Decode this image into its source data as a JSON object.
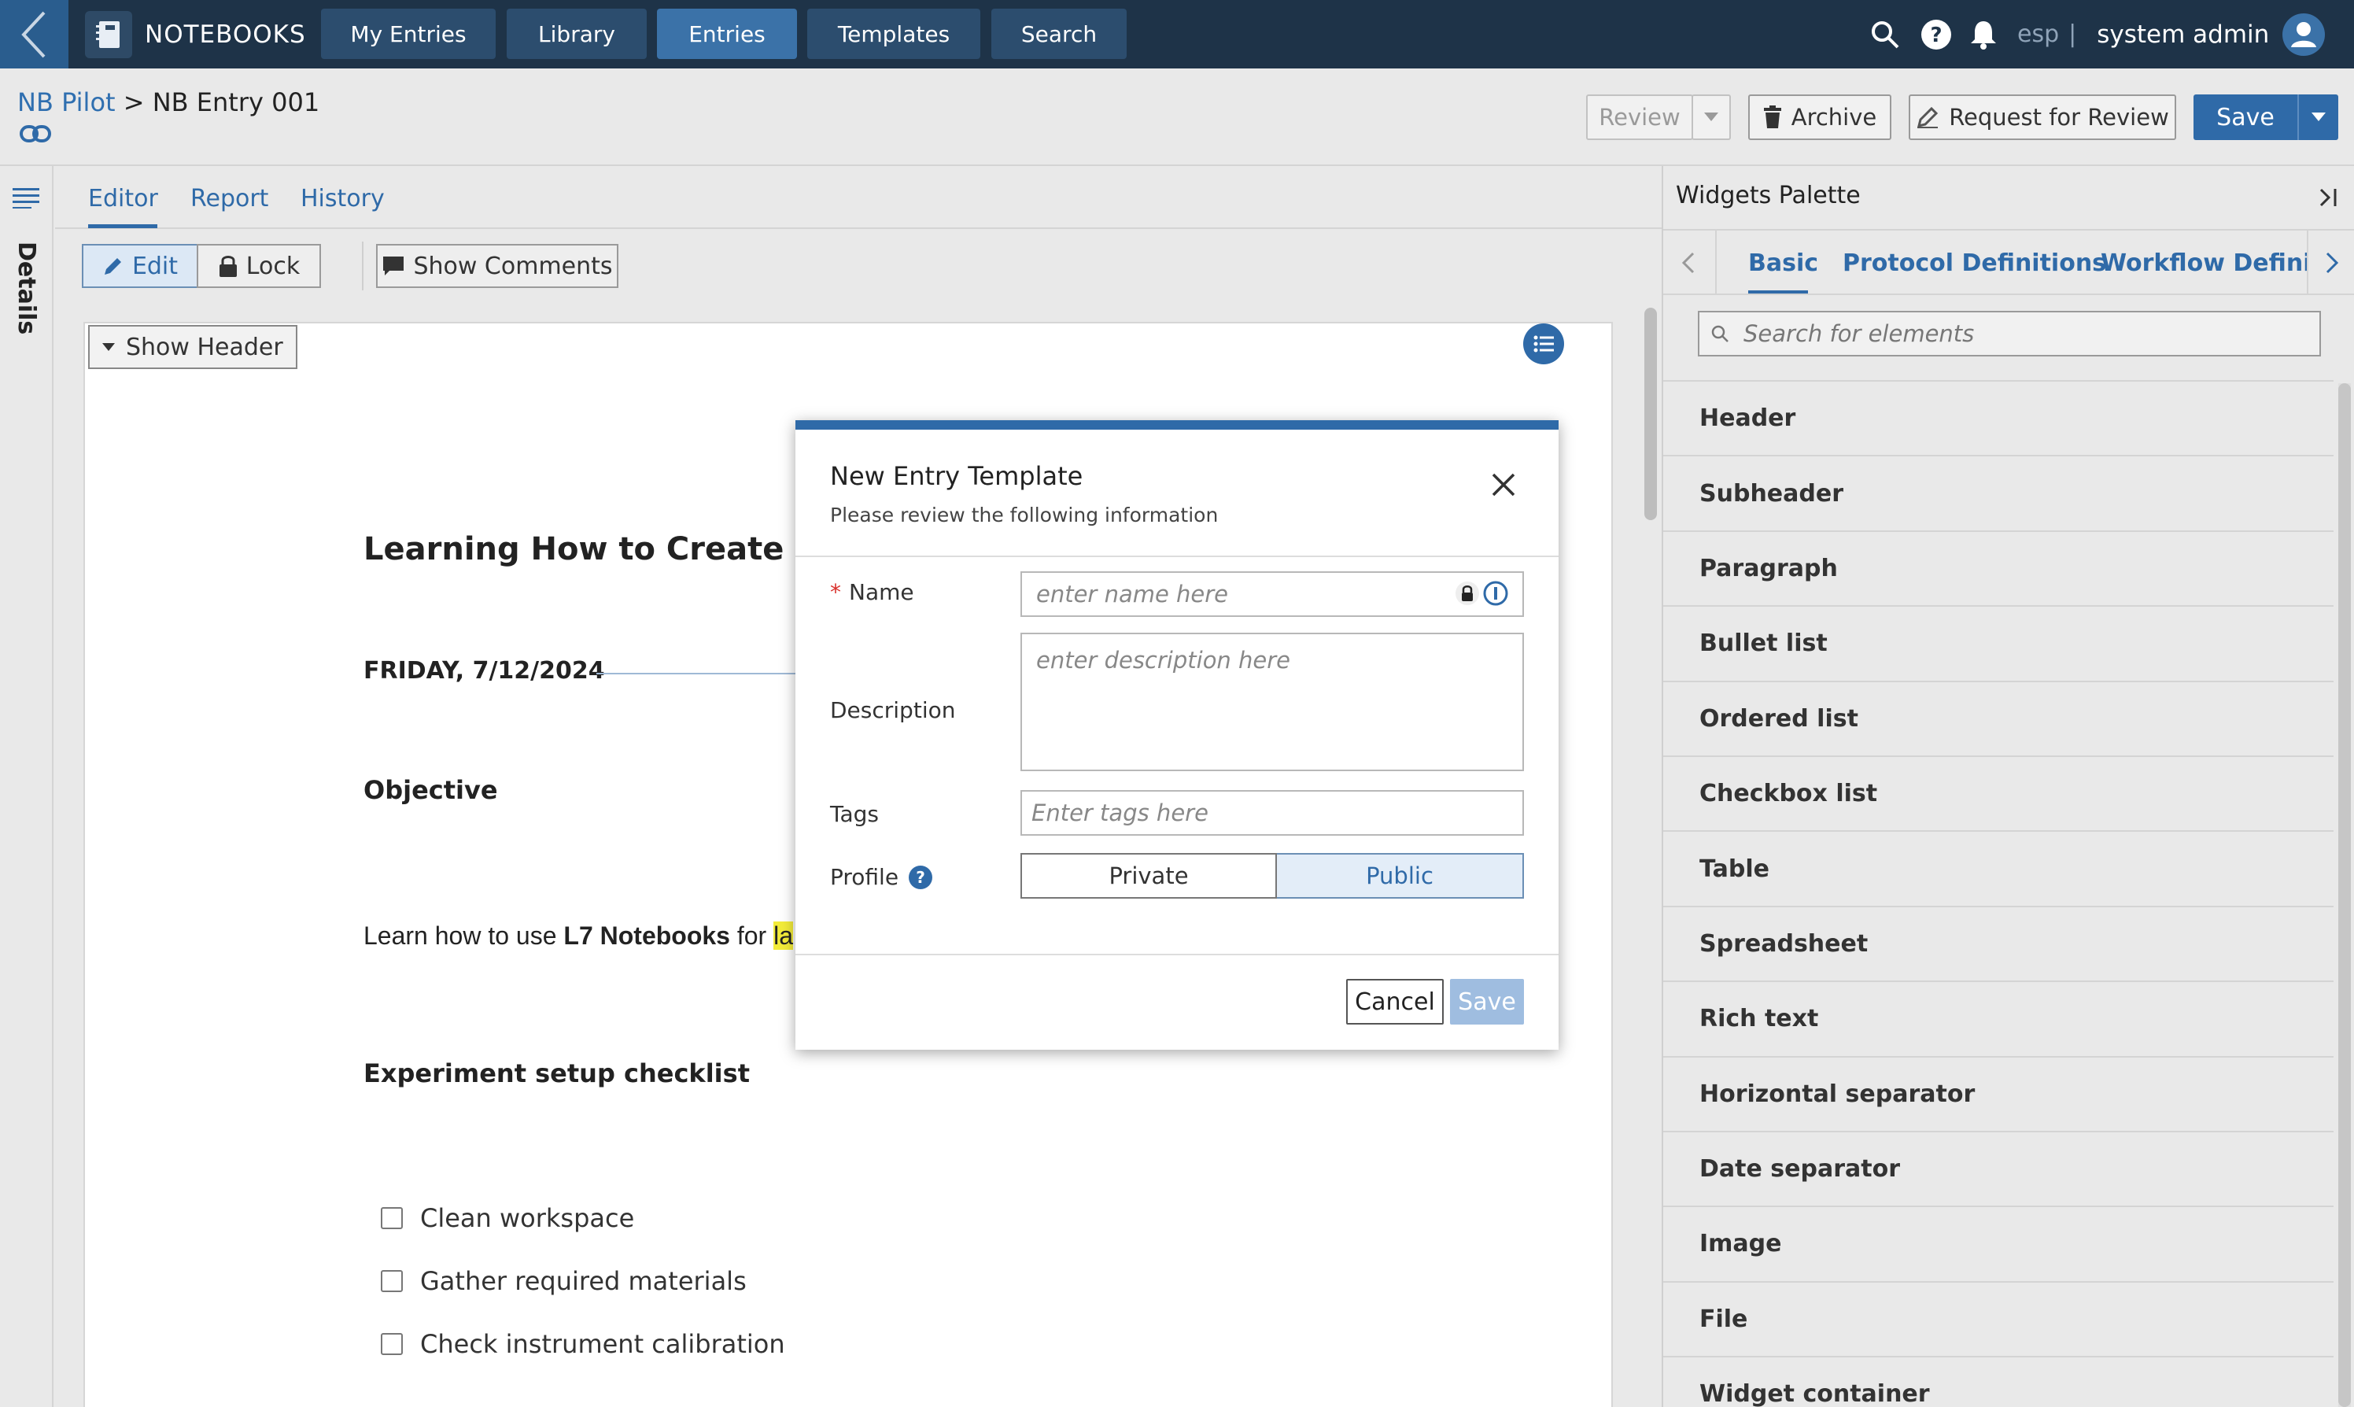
{
  "nav": {
    "brand": "NOTEBOOKS",
    "items": [
      "My Entries",
      "Library",
      "Entries",
      "Templates",
      "Search"
    ],
    "active_index": 2,
    "lang": "esp",
    "lang_sep": "|",
    "user": "system admin"
  },
  "header": {
    "crumb_parent": "NB Pilot",
    "crumb_sep": " > ",
    "crumb_current": "NB Entry 001",
    "review_label": "Review",
    "archive_label": "Archive",
    "request_review_label": "Request for Review",
    "save_label": "Save"
  },
  "details": {
    "label": "Details"
  },
  "editor": {
    "tabs": [
      "Editor",
      "Report",
      "History"
    ],
    "active_tab": 0,
    "edit_label": "Edit",
    "lock_label": "Lock",
    "show_comments_label": "Show Comments",
    "show_header_label": "Show Header",
    "doc": {
      "title": "Learning How to Create Entri",
      "date": "FRIDAY, 7/12/2024",
      "objective_heading": "Objective",
      "para_prefix": "Learn how to use ",
      "para_bold": "L7 Notebooks",
      "para_mid": " for ",
      "para_highlight": "la",
      "checklist_heading": "Experiment setup checklist",
      "checklist": [
        "Clean workspace",
        "Gather required materials",
        "Check instrument calibration"
      ]
    }
  },
  "palette": {
    "title": "Widgets Palette",
    "tabs": [
      "Basic",
      "Protocol Definitions",
      "Workflow Definitio"
    ],
    "active_tab": 0,
    "search_placeholder": "Search for elements",
    "items": [
      "Header",
      "Subheader",
      "Paragraph",
      "Bullet list",
      "Ordered list",
      "Checkbox list",
      "Table",
      "Spreadsheet",
      "Rich text",
      "Horizontal separator",
      "Date separator",
      "Image",
      "File",
      "Widget container"
    ]
  },
  "modal": {
    "title": "New Entry Template",
    "subtitle": "Please review the following information",
    "required_mark": "*",
    "name_label": "Name",
    "name_placeholder": "enter name here",
    "description_label": "Description",
    "description_placeholder": "enter description here",
    "tags_label": "Tags",
    "tags_placeholder": "Enter tags here",
    "profile_label": "Profile",
    "profile_options": [
      "Private",
      "Public"
    ],
    "profile_selected": "Public",
    "cancel_label": "Cancel",
    "save_label": "Save"
  },
  "colors": {
    "topbar": "#1e3348",
    "accent": "#2f6aa8",
    "required": "#d9302c",
    "highlight": "#f3ec3a"
  }
}
